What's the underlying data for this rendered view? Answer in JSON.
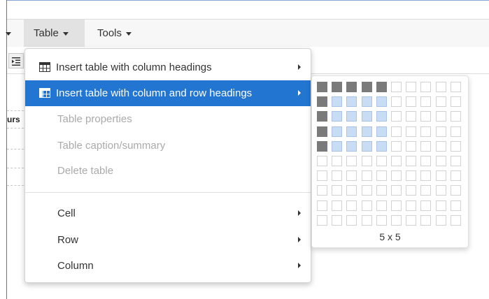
{
  "menubar": {
    "table_label": "Table",
    "tools_label": "Tools"
  },
  "editor": {
    "fragment_text": "urs"
  },
  "table_menu": {
    "items": [
      {
        "label": "Insert table with column headings",
        "state": "normal",
        "icon": "table-grid-icon",
        "submenu": true
      },
      {
        "label": "Insert table with column and row headings",
        "state": "active",
        "icon": "table-grid-icon",
        "submenu": true
      },
      {
        "label": "Table properties",
        "state": "disabled",
        "submenu": false
      },
      {
        "label": "Table caption/summary",
        "state": "disabled",
        "submenu": false
      },
      {
        "label": "Delete table",
        "state": "disabled",
        "submenu": false
      },
      {
        "label": "Cell",
        "state": "normal",
        "submenu": true
      },
      {
        "label": "Row",
        "state": "normal",
        "submenu": true
      },
      {
        "label": "Column",
        "state": "normal",
        "submenu": true
      }
    ]
  },
  "grid_picker": {
    "columns": 10,
    "rows": 10,
    "selected_columns": 5,
    "selected_rows": 5,
    "size_label": "5 x 5"
  },
  "colors": {
    "accent": "#2276d2",
    "header_cell": "#7a7a7a",
    "selected_cell": "#c8dcf4"
  }
}
